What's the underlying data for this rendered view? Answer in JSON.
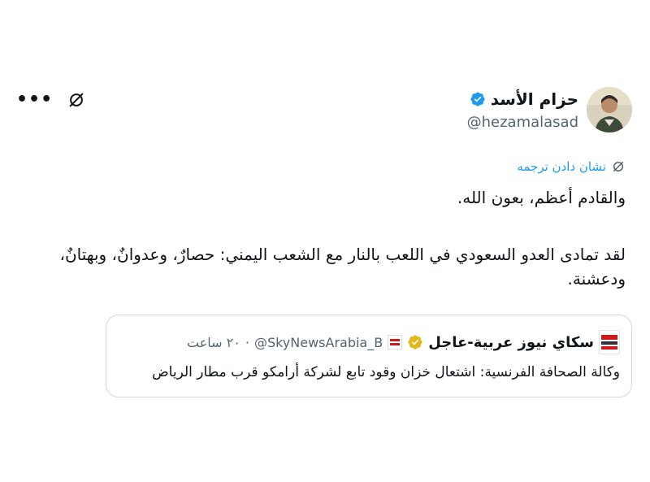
{
  "author": {
    "name": "حزام الأسد",
    "handle": "@hezamalasad",
    "verified_color": "#1d9bf0"
  },
  "header_actions": {
    "more_label": "•••",
    "grok_icon": "grok-icon"
  },
  "translate": {
    "label": "نشان دادن ترجمه",
    "icon": "grok-icon"
  },
  "tweet": {
    "line1": "والقادم أعظم، بعون الله.",
    "line2": "لقد تمادى العدو السعودي في اللعب بالنار مع الشعب اليمني: حصارٌ، وعدوانٌ، وبهتانٌ،",
    "line3": "ودعشنة."
  },
  "quote": {
    "name": "سكاي نيوز عربية-عاجل",
    "handle": "@SkyNewsArabia_B",
    "separator": "·",
    "time": "٢٠ ساعت",
    "text": "وكالة الصحافة الفرنسية: اشتعال خزان وقود تابع لشركة أرامكو قرب مطار الرياض",
    "verified_color": "#e2b719"
  },
  "colors": {
    "accent": "#1d9bf0",
    "muted": "#536471",
    "border": "#cfd9de"
  }
}
